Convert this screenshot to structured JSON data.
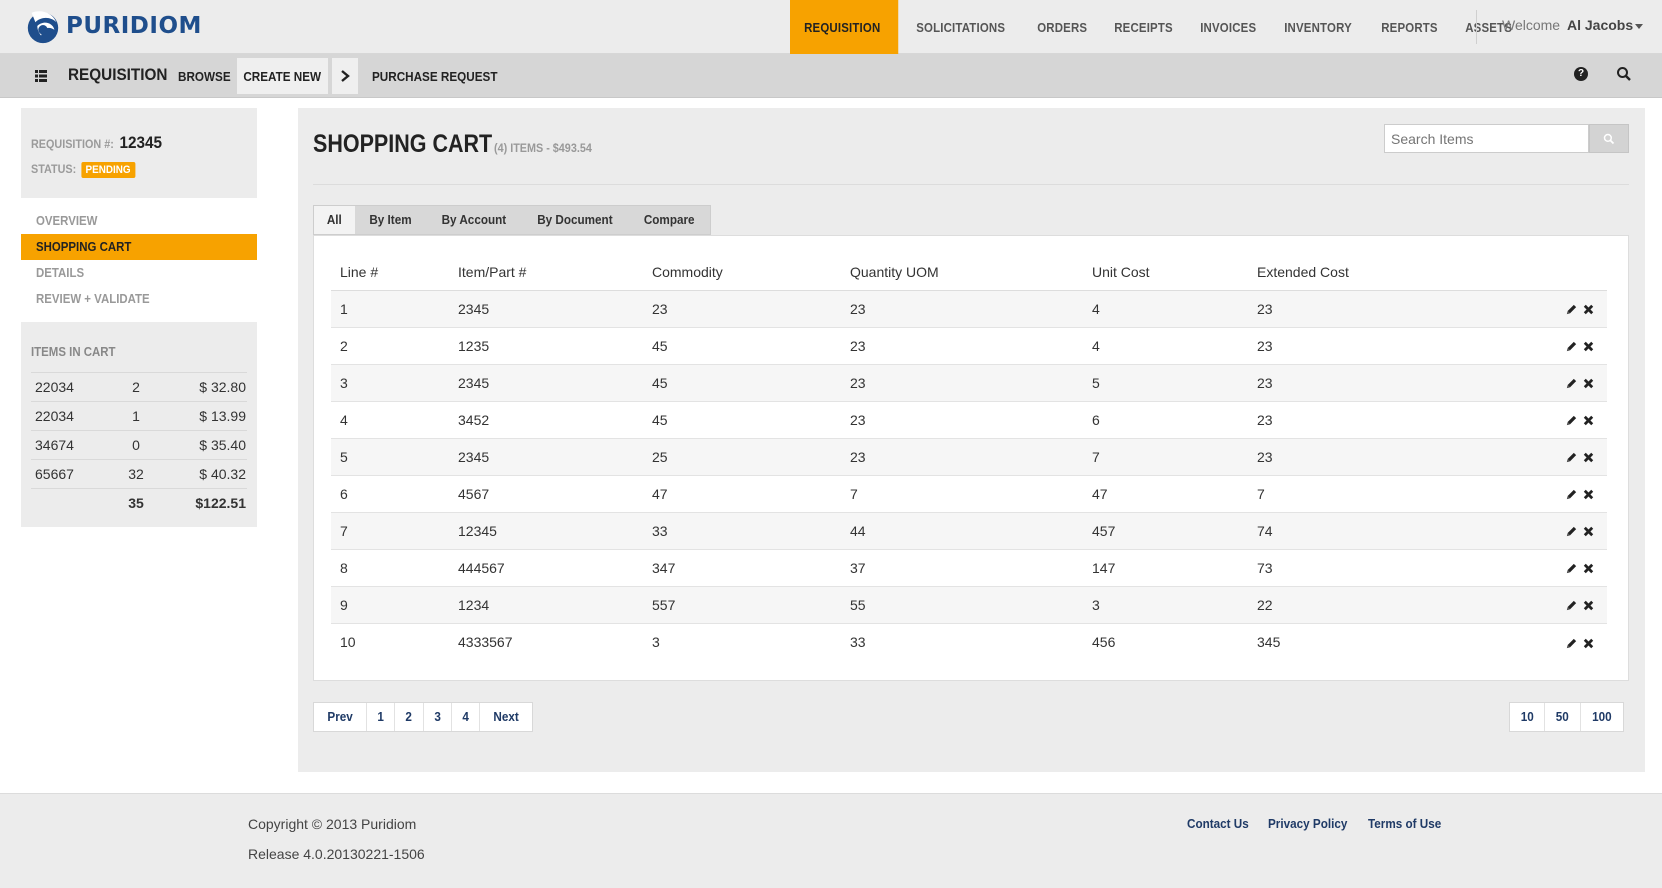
{
  "brand": {
    "name": "PURIDIOM"
  },
  "topnav": {
    "items": [
      "REQUISITION",
      "SOLICITATIONS",
      "ORDERS",
      "RECEIPTS",
      "INVOICES",
      "INVENTORY",
      "REPORTS",
      "ASSETS"
    ],
    "active": "REQUISITION",
    "welcome_label": "Welcome",
    "user": "Al Jacobs"
  },
  "subbar": {
    "title": "REQUISITION",
    "browse": "BROWSE",
    "create_new": "CREATE NEW",
    "purchase_request": "PURCHASE REQUEST"
  },
  "requisition": {
    "label": "REQUISITION #:",
    "number": "12345",
    "status_label": "STATUS:",
    "status": "PENDING"
  },
  "sidenav": {
    "items": [
      "OVERVIEW",
      "SHOPPING CART",
      "DETAILS",
      "REVIEW + VALIDATE"
    ],
    "active": "SHOPPING CART"
  },
  "cart": {
    "title": "ITEMS IN CART",
    "rows": [
      {
        "id": "22034",
        "qty": "2",
        "price": "$ 32.80"
      },
      {
        "id": "22034",
        "qty": "1",
        "price": "$ 13.99"
      },
      {
        "id": "34674",
        "qty": "0",
        "price": "$ 35.40"
      },
      {
        "id": "65667",
        "qty": "32",
        "price": "$ 40.32"
      }
    ],
    "total_qty": "35",
    "total_price": "$122.51"
  },
  "main": {
    "title": "SHOPPING CART",
    "subtitle": "(4) ITEMS - $493.54",
    "search_placeholder": "Search Items",
    "tabs": [
      "All",
      "By Item",
      "By Account",
      "By Document",
      "Compare"
    ],
    "active_tab": "All"
  },
  "table": {
    "columns": [
      "Line #",
      "Item/Part #",
      "Commodity",
      "Quantity UOM",
      "Unit Cost",
      "Extended Cost"
    ],
    "rows": [
      [
        "1",
        "2345",
        "23",
        "23",
        "4",
        "23"
      ],
      [
        "2",
        "1235",
        "45",
        "23",
        "4",
        "23"
      ],
      [
        "3",
        "2345",
        "45",
        "23",
        "5",
        "23"
      ],
      [
        "4",
        "3452",
        "45",
        "23",
        "6",
        "23"
      ],
      [
        "5",
        "2345",
        "25",
        "23",
        "7",
        "23"
      ],
      [
        "6",
        "4567",
        "47",
        "7",
        "47",
        "7"
      ],
      [
        "7",
        "12345",
        "33",
        "44",
        "457",
        "74"
      ],
      [
        "8",
        "444567",
        "347",
        "37",
        "147",
        "73"
      ],
      [
        "9",
        "1234",
        "557",
        "55",
        "3",
        "22"
      ],
      [
        "10",
        "4333567",
        "3",
        "33",
        "456",
        "345"
      ]
    ]
  },
  "pagination": {
    "prev": "Prev",
    "pages": [
      "1",
      "2",
      "3",
      "4"
    ],
    "next": "Next",
    "per_page": [
      "10",
      "50",
      "100"
    ]
  },
  "footer": {
    "copyright": "Copyright © 2013 Puridiom",
    "release": "Release 4.0.20130221-1506",
    "links": [
      "Contact Us",
      "Privacy Policy",
      "Terms of Use"
    ]
  },
  "colors": {
    "accent": "#f7a200",
    "brand": "#1f4e8c",
    "link": "#1f3a66"
  }
}
